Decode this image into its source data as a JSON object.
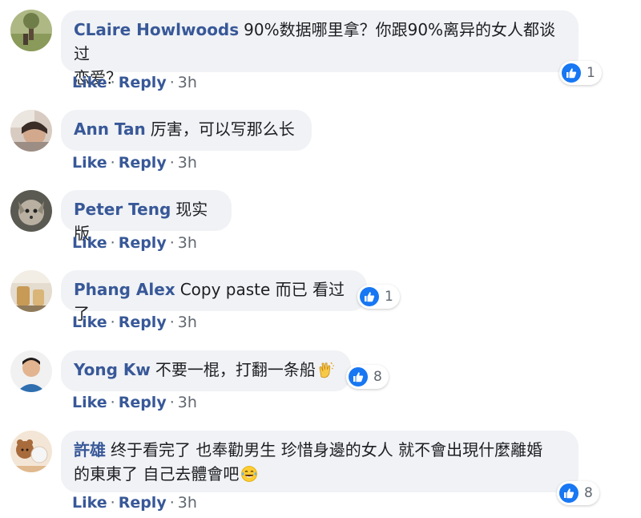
{
  "comments": [
    {
      "author": "CLaire Howlwoods",
      "text_line1": "90%数据哪里拿？你跟90%离异的女人都谈过",
      "text_line2": "恋爱？",
      "like_count": "1",
      "like_label": "Like",
      "reply_label": "Reply",
      "separator": "·",
      "time": "3h"
    },
    {
      "author": "Ann Tan",
      "text": "厉害，可以写那么长",
      "like_label": "Like",
      "reply_label": "Reply",
      "separator": "·",
      "time": "3h"
    },
    {
      "author": "Peter Teng",
      "text": "现实版",
      "like_label": "Like",
      "reply_label": "Reply",
      "separator": "·",
      "time": "3h"
    },
    {
      "author": "Phang Alex",
      "text": "Copy paste 而已 看过了",
      "like_count": "1",
      "like_label": "Like",
      "reply_label": "Reply",
      "separator": "·",
      "time": "3h"
    },
    {
      "author": "Yong Kw",
      "text": "不要一棍，打翻一条船",
      "emoji": "clapping-hands",
      "like_count": "8",
      "like_label": "Like",
      "reply_label": "Reply",
      "separator": "·",
      "time": "3h"
    },
    {
      "author": "許雄",
      "text_line1": "终于看完了 也奉勸男生 珍惜身邊的女人 就不會出現什麼離婚",
      "text_line2": "的東東了 自己去體會吧",
      "emoji": "tears-of-joy",
      "like_count": "8",
      "like_label": "Like",
      "reply_label": "Reply",
      "separator": "·",
      "time": "3h"
    }
  ],
  "colors": {
    "bubble_bg": "#f0f2f5",
    "author": "#385898",
    "like_blue": "#1877f2",
    "meta_text": "#606770"
  }
}
